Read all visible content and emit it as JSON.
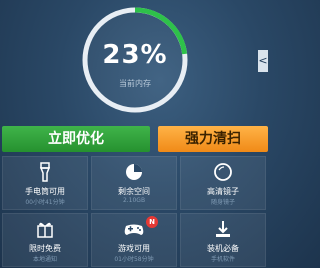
{
  "memory": {
    "percent_text": "23%",
    "percent": 0.23,
    "caption": "当前内存"
  },
  "side_tab": {
    "glyph": "<"
  },
  "actions": {
    "optimize_label": "立即优化",
    "force_clean_label": "强力清扫"
  },
  "tiles": [
    {
      "title": "手电筒可用",
      "subtitle": "00小时41分钟",
      "icon": "flashlight-icon"
    },
    {
      "title": "剩余空间",
      "subtitle": "2.10GB",
      "icon": "storage-pie-icon"
    },
    {
      "title": "高清镜子",
      "subtitle": "随身镜子",
      "icon": "mirror-icon"
    },
    {
      "title": "限时免费",
      "subtitle": "本地通知",
      "icon": "gift-icon"
    },
    {
      "title": "游戏可用",
      "subtitle": "01小时58分钟",
      "icon": "gamepad-icon",
      "badge": "N"
    },
    {
      "title": "装机必备",
      "subtitle": "手机软件",
      "icon": "download-icon"
    }
  ],
  "colors": {
    "ring_used": "#2ec14a",
    "ring_track": "#e8eef4",
    "optimize": "#2f9e3a",
    "force_clean": "#f5a02a"
  }
}
